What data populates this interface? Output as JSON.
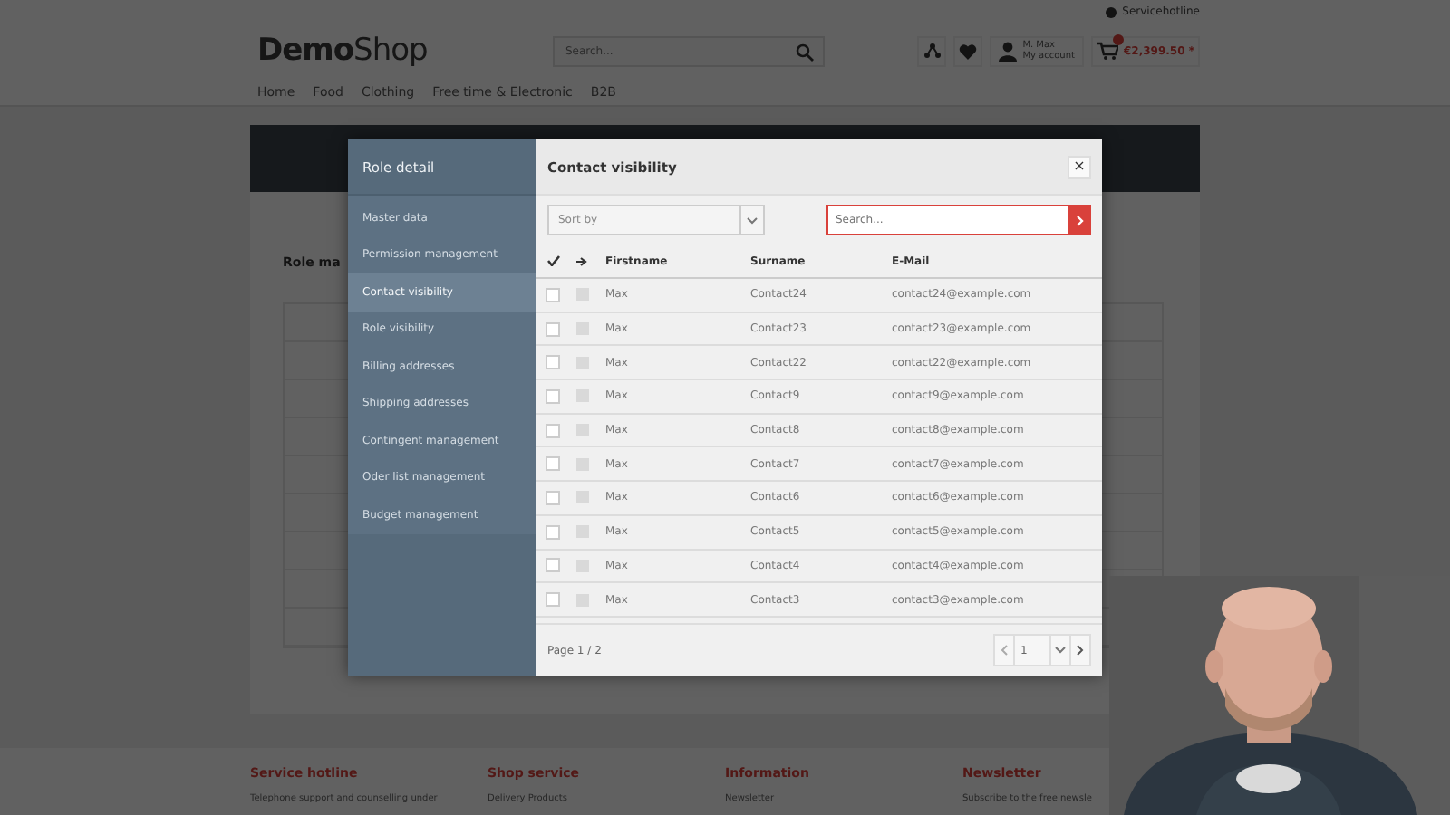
{
  "shop_header": {
    "service_link": "Servicehotline",
    "logo": "**Demo**Shop",
    "search_placeholder": "Search...",
    "account": {
      "name": "M. Max",
      "subtitle": "My account"
    },
    "cart_total": "€2,399.50 *"
  },
  "nav": [
    "Home",
    "Food",
    "Clothing",
    "Free time & Electronic",
    "B2B"
  ],
  "page": {
    "heading": "Role ma"
  },
  "footer": [
    {
      "title": "Service hotline",
      "text": "Telephone support and counselling under"
    },
    {
      "title": "Shop service",
      "text": "Delivery Products"
    },
    {
      "title": "Information",
      "text": "Newsletter"
    },
    {
      "title": "Newsletter",
      "text": "Subscribe to the free newsle"
    }
  ],
  "modal": {
    "sidebar_title": "Role detail",
    "menu": [
      {
        "label": "Master data",
        "selected": false
      },
      {
        "label": "Permission management",
        "selected": false
      },
      {
        "label": "Contact visibility",
        "selected": true
      },
      {
        "label": "Role visibility",
        "selected": false
      },
      {
        "label": "Billing addresses",
        "selected": false
      },
      {
        "label": "Shipping addresses",
        "selected": false
      },
      {
        "label": "Contingent management",
        "selected": false
      },
      {
        "label": "Oder list management",
        "selected": false
      },
      {
        "label": "Budget management",
        "selected": false
      }
    ],
    "title": "Contact visibility",
    "close": "×",
    "sort": {
      "placeholder": "Sort by"
    },
    "search": {
      "placeholder": "Search..."
    },
    "columns": [
      "Firstname",
      "Surname",
      "E-Mail"
    ],
    "rows": [
      {
        "firstname": "Max",
        "surname": "Contact24",
        "email": "contact24@example.com",
        "checked": false,
        "inherited": false
      },
      {
        "firstname": "Max",
        "surname": "Contact23",
        "email": "contact23@example.com",
        "checked": false,
        "inherited": false
      },
      {
        "firstname": "Max",
        "surname": "Contact22",
        "email": "contact22@example.com",
        "checked": false,
        "inherited": false
      },
      {
        "firstname": "Max",
        "surname": "Contact9",
        "email": "contact9@example.com",
        "checked": false,
        "inherited": false
      },
      {
        "firstname": "Max",
        "surname": "Contact8",
        "email": "contact8@example.com",
        "checked": false,
        "inherited": false
      },
      {
        "firstname": "Max",
        "surname": "Contact7",
        "email": "contact7@example.com",
        "checked": false,
        "inherited": false
      },
      {
        "firstname": "Max",
        "surname": "Contact6",
        "email": "contact6@example.com",
        "checked": false,
        "inherited": false
      },
      {
        "firstname": "Max",
        "surname": "Contact5",
        "email": "contact5@example.com",
        "checked": false,
        "inherited": false
      },
      {
        "firstname": "Max",
        "surname": "Contact4",
        "email": "contact4@example.com",
        "checked": false,
        "inherited": false
      },
      {
        "firstname": "Max",
        "surname": "Contact3",
        "email": "contact3@example.com",
        "checked": false,
        "inherited": false
      }
    ],
    "pager": {
      "text": "Page 1 / 2",
      "page": "1"
    }
  }
}
